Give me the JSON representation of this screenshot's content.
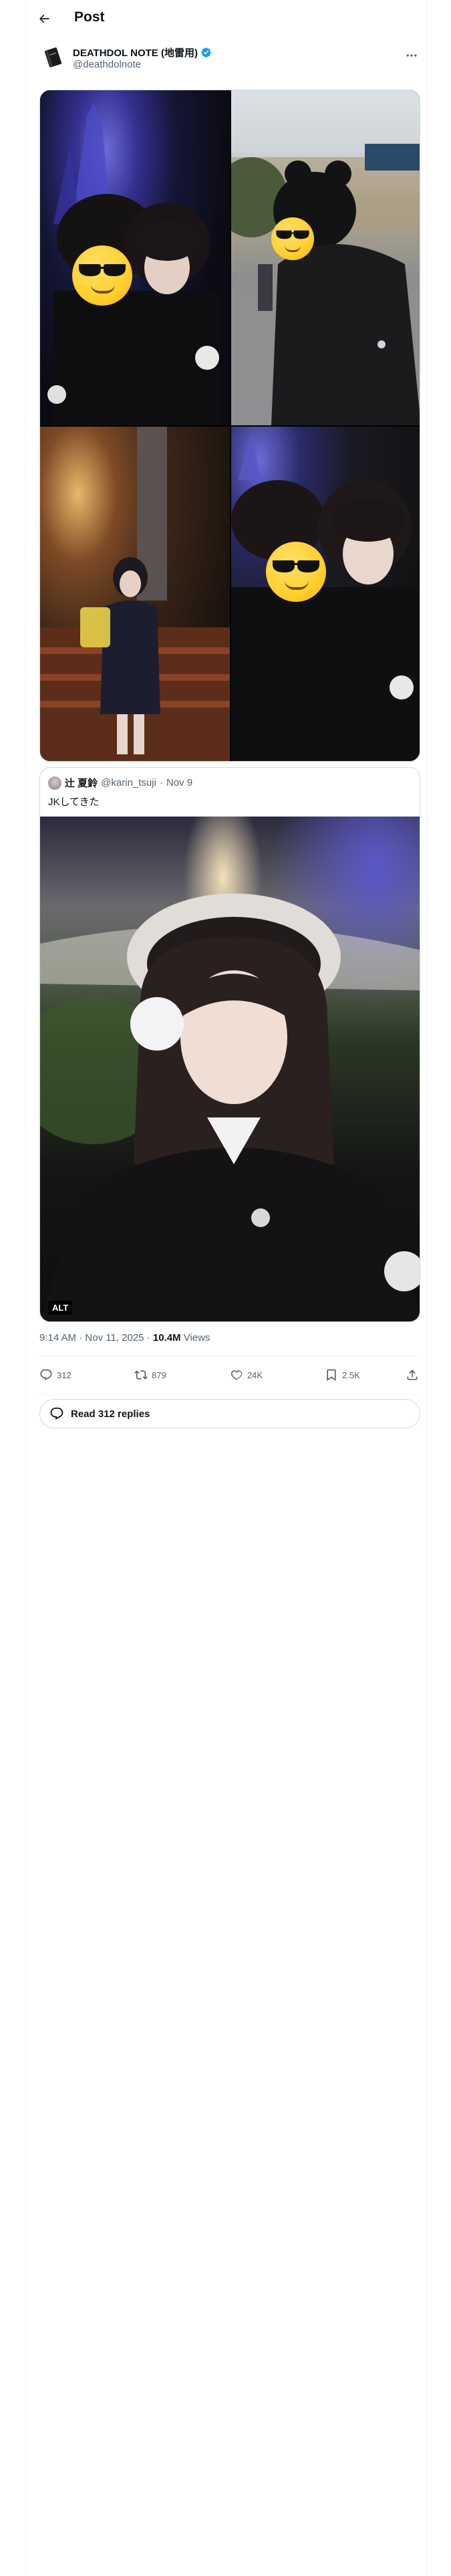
{
  "header": {
    "title": "Post"
  },
  "author": {
    "name": "DEATHDOL NOTE (地雷用)",
    "handle": "@deathdolnote"
  },
  "quote": {
    "name": "辻 夏鈴",
    "handle": "@karin_tsuji",
    "date": "Nov 9",
    "text": "JKしてきた",
    "alt_label": "ALT"
  },
  "meta": {
    "time": "9:14 AM",
    "date": "Nov 11, 2025",
    "views_count": "10.4M",
    "views_label": "Views"
  },
  "actions": {
    "replies": "312",
    "reposts": "879",
    "likes": "24K",
    "bookmarks": "2.5K"
  },
  "read_replies_label": "Read 312 replies",
  "colors": {
    "text": "#0f1419",
    "secondary": "#536471",
    "border": "#cfd9de",
    "verified": "#1d9bf0"
  }
}
